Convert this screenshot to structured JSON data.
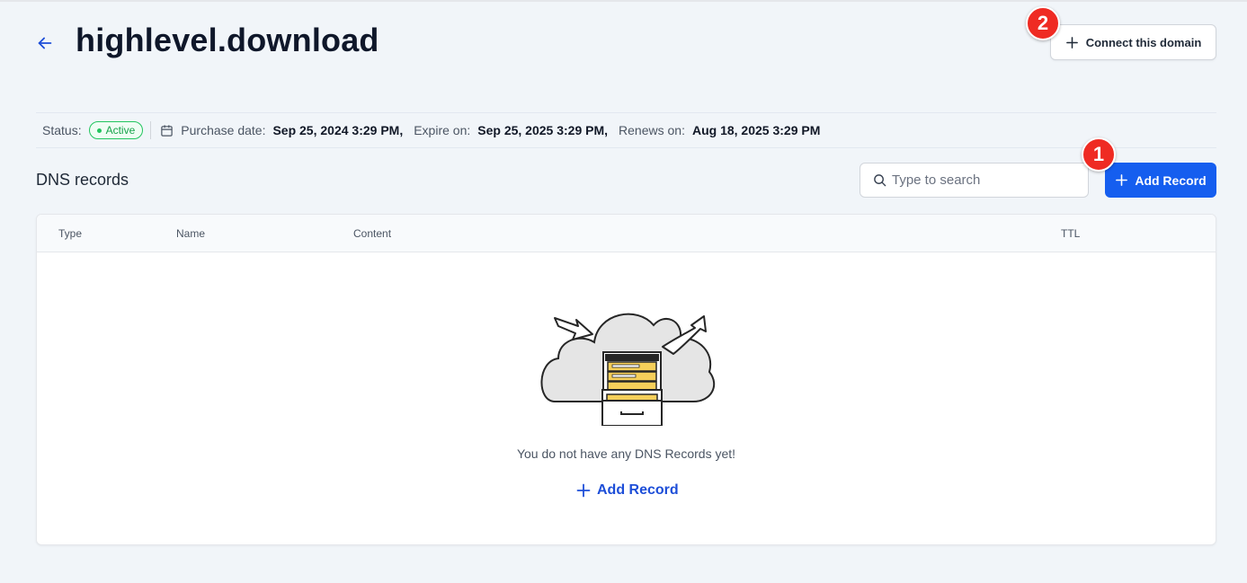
{
  "header": {
    "title": "highlevel.download",
    "connect_label": "Connect this domain"
  },
  "annotations": {
    "marker_1": "1",
    "marker_2": "2"
  },
  "status_bar": {
    "status_label": "Status:",
    "status_value": "Active",
    "purchase_label": "Purchase date:",
    "purchase_value": "Sep 25, 2024 3:29 PM,",
    "expire_label": "Expire on:",
    "expire_value": "Sep 25, 2025 3:29 PM,",
    "renews_label": "Renews on:",
    "renews_value": "Aug 18, 2025 3:29 PM"
  },
  "dns": {
    "title": "DNS records",
    "search_placeholder": "Type to search",
    "search_value": "",
    "add_label": "Add Record",
    "columns": [
      "Type",
      "Name",
      "Content",
      "TTL"
    ],
    "rows": [],
    "empty_message": "You do not have any DNS Records yet!",
    "empty_add_label": "Add Record"
  },
  "icons": {
    "back": "arrow-left-icon",
    "plus": "plus-icon",
    "calendar": "calendar-icon",
    "search": "search-icon",
    "empty": "cloud-file-cabinet-illustration"
  },
  "colors": {
    "primary": "#155eef",
    "link": "#1d4ed8",
    "active": "#16a34a",
    "marker": "#ef2b23",
    "background": "#f1f5f9"
  }
}
